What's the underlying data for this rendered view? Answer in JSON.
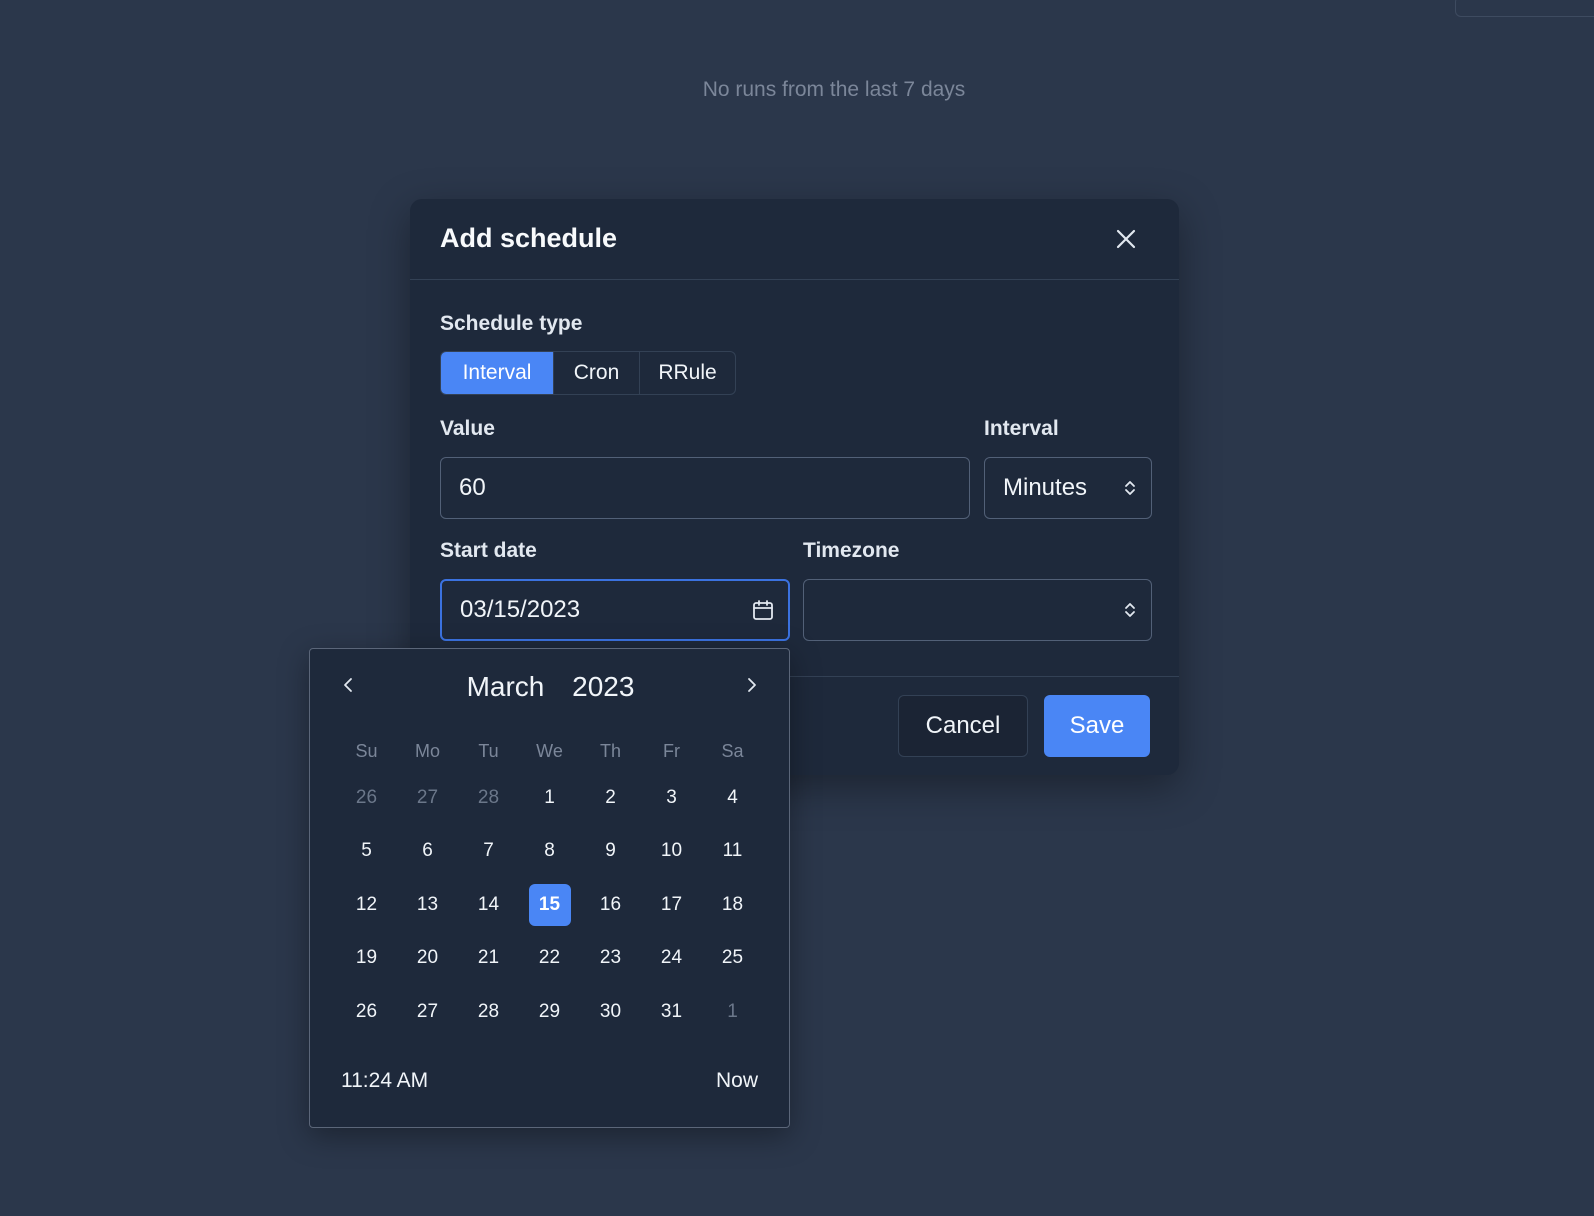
{
  "background": {
    "empty_message": "No runs from the last 7 days"
  },
  "modal": {
    "title": "Add schedule",
    "close_icon": "close-icon",
    "schedule_type": {
      "label": "Schedule type",
      "options": [
        "Interval",
        "Cron",
        "RRule"
      ],
      "selected": "Interval"
    },
    "value": {
      "label": "Value",
      "current": "60"
    },
    "interval": {
      "label": "Interval",
      "selected": "Minutes",
      "icon": "chevron-up-down-icon"
    },
    "start_date": {
      "label": "Start date",
      "current": "03/15/2023",
      "icon": "calendar-icon"
    },
    "timezone": {
      "label": "Timezone",
      "selected": "",
      "icon": "chevron-up-down-icon"
    },
    "buttons": {
      "cancel": "Cancel",
      "save": "Save"
    }
  },
  "calendar": {
    "month": "March",
    "year": "2023",
    "weekdays": [
      "Su",
      "Mo",
      "Tu",
      "We",
      "Th",
      "Fr",
      "Sa"
    ],
    "weeks": [
      [
        "26",
        "27",
        "28",
        "1",
        "2",
        "3",
        "4"
      ],
      [
        "5",
        "6",
        "7",
        "8",
        "9",
        "10",
        "11"
      ],
      [
        "12",
        "13",
        "14",
        "15",
        "16",
        "17",
        "18"
      ],
      [
        "19",
        "20",
        "21",
        "22",
        "23",
        "24",
        "25"
      ],
      [
        "26",
        "27",
        "28",
        "29",
        "30",
        "31",
        "1"
      ]
    ],
    "selected_day": "15",
    "time": "11:24 AM",
    "now_label": "Now",
    "colors": {
      "accent": "#4a86f5",
      "muted": "#6b778a"
    }
  }
}
